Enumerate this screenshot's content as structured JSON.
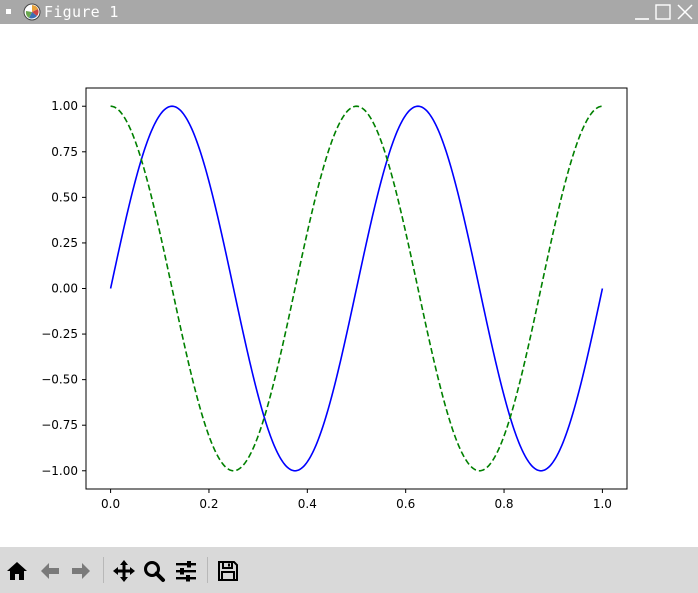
{
  "window": {
    "title": "Figure 1"
  },
  "toolbar": {
    "buttons": [
      {
        "name": "home",
        "icon": "home-icon"
      },
      {
        "name": "back",
        "icon": "arrow-left-icon"
      },
      {
        "name": "forward",
        "icon": "arrow-right-icon"
      },
      {
        "name": "pan",
        "icon": "move-icon"
      },
      {
        "name": "zoom",
        "icon": "magnifier-icon"
      },
      {
        "name": "configure-subplots",
        "icon": "sliders-icon"
      },
      {
        "name": "save",
        "icon": "floppy-disk-icon"
      }
    ]
  },
  "chart_data": {
    "type": "line",
    "title": "",
    "xlabel": "",
    "ylabel": "",
    "xlim": [
      -0.05,
      1.05
    ],
    "ylim": [
      -1.1,
      1.1
    ],
    "xticks": [
      "0.0",
      "0.2",
      "0.4",
      "0.6",
      "0.8",
      "1.0"
    ],
    "yticks": [
      "1.00",
      "0.75",
      "0.50",
      "0.25",
      "0.00",
      "−0.25",
      "−0.50",
      "−0.75",
      "−1.00"
    ],
    "grid": false,
    "series": [
      {
        "function": "sin(2*pi*2*x)",
        "x_range": [
          0,
          1
        ],
        "color": "#0000ff",
        "linestyle": "solid",
        "x": [
          0,
          0.125,
          0.25,
          0.375,
          0.5,
          0.625,
          0.75,
          0.875,
          1.0
        ],
        "y": [
          0,
          1,
          0,
          -1,
          0,
          1,
          0,
          -1,
          0
        ]
      },
      {
        "function": "cos(2*pi*2*x)",
        "x_range": [
          0,
          1
        ],
        "color": "#008000",
        "linestyle": "dashed",
        "x": [
          0,
          0.125,
          0.25,
          0.375,
          0.5,
          0.625,
          0.75,
          0.875,
          1.0
        ],
        "y": [
          1,
          0,
          -1,
          0,
          1,
          0,
          -1,
          0,
          1
        ]
      }
    ]
  }
}
